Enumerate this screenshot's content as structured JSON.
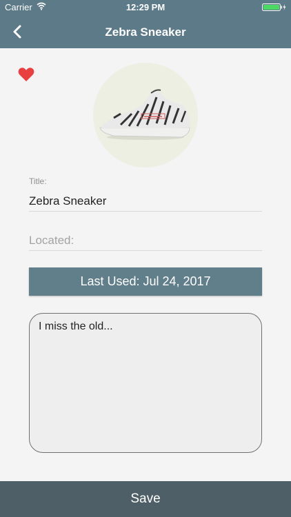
{
  "status_bar": {
    "carrier": "Carrier",
    "time": "12:29 PM",
    "battery_color": "#4cd964"
  },
  "nav": {
    "title": "Zebra Sneaker",
    "back_icon": "chevron-left-icon",
    "background": "#5d7a88"
  },
  "favorite": {
    "icon": "heart-icon",
    "color": "#e84040"
  },
  "product_image": {
    "icon": "sneaker-image"
  },
  "form": {
    "title_label": "Title:",
    "title_value": "Zebra Sneaker",
    "located_placeholder": "Located:",
    "last_used_label": "Last Used: Jul 24, 2017",
    "notes_value": "I miss the old..."
  },
  "footer": {
    "save_label": "Save"
  }
}
